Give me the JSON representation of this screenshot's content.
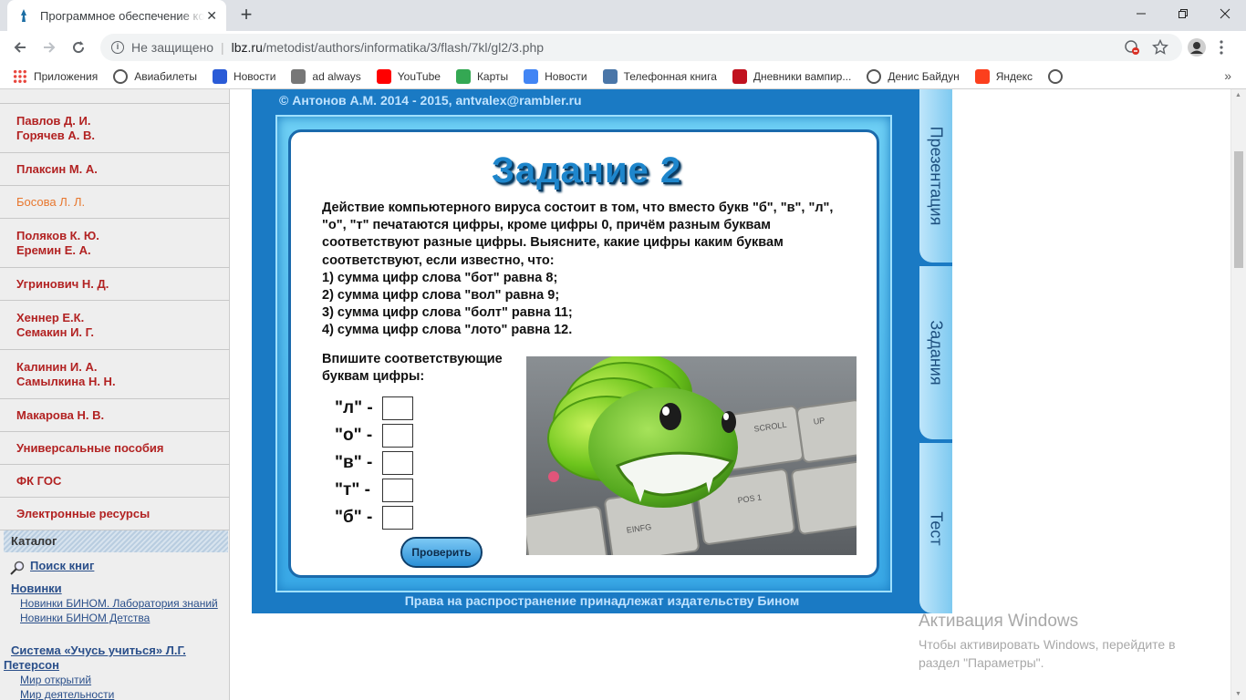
{
  "browser": {
    "tab_title": "Программное обеспечение ко",
    "security_label": "Не защищено",
    "url_domain": "lbz.ru",
    "url_path": "/metodist/authors/informatika/3/flash/7kl/gl2/3.php"
  },
  "bookmarks": [
    {
      "label": "Приложения",
      "icon": "apps-icon",
      "color": "#e8453c"
    },
    {
      "label": "Авиабилеты",
      "icon": "globe-icon",
      "color": "#555555"
    },
    {
      "label": "Новости",
      "icon": "chat-icon",
      "color": "#2a5bd7"
    },
    {
      "label": "ad always",
      "icon": "page-icon",
      "color": "#777777"
    },
    {
      "label": "YouTube",
      "icon": "youtube-icon",
      "color": "#ff0000"
    },
    {
      "label": "Карты",
      "icon": "maps-icon",
      "color": "#34a853"
    },
    {
      "label": "Новости",
      "icon": "gnews-icon",
      "color": "#4285f4"
    },
    {
      "label": "Телефонная книга",
      "icon": "vk-icon",
      "color": "#4a76a8"
    },
    {
      "label": "Дневники вампир...",
      "icon": "wa-icon",
      "color": "#c1121f"
    },
    {
      "label": "Денис Байдун",
      "icon": "globe-icon",
      "color": "#555555"
    },
    {
      "label": "Яндекс",
      "icon": "yandex-icon",
      "color": "#fc3f1d"
    }
  ],
  "sidebar": {
    "items": [
      {
        "line1": "Павлов Д. И.",
        "line2": "Горячев А. В."
      },
      {
        "line1": "Плаксин М. А.",
        "line2": ""
      },
      {
        "line1": "Босова Л. Л.",
        "line2": ""
      },
      {
        "line1": "Поляков К. Ю.",
        "line2": "Еремин Е. А."
      },
      {
        "line1": "Угринович Н. Д.",
        "line2": ""
      },
      {
        "line1": "Хеннер Е.К.",
        "line2": "Семакин И. Г."
      },
      {
        "line1": "Калинин И. А.",
        "line2": "Самылкина Н. Н."
      },
      {
        "line1": "Макарова Н. В.",
        "line2": ""
      },
      {
        "line1": "Универсальные пособия",
        "line2": ""
      },
      {
        "line1": "ФК ГОС",
        "line2": ""
      },
      {
        "line1": "Электронные ресурсы",
        "line2": ""
      }
    ],
    "catalog_title": "Каталог",
    "search_books": "Поиск книг",
    "novelties": "Новинки",
    "novelties_binom_lab": "Новинки БИНОМ. Лаборатория знаний",
    "novelties_binom_kids": "Новинки БИНОМ Детства",
    "system_line1": "Система «Учусь учиться» Л.Г.",
    "system_line2": "Петерсон",
    "world_open": "Мир открытий",
    "world_activity": "Мир деятельности"
  },
  "flash": {
    "copyright": "© Антонов А.М. 2014 - 2015, antvalex@rambler.ru",
    "task_title": "Задание 2",
    "task_lines": [
      "Действие компьютерного вируса состоит в том, что вместо букв \"б\", \"в\", \"л\",",
      "\"о\", \"т\" печатаются цифры, кроме цифры 0, причём разным буквам",
      "соответствуют разные цифры. Выясните, какие цифры каким буквам",
      "соответствуют, если известно, что:",
      "1) сумма цифр слова \"бот\" равна 8;",
      "2) сумма цифр слова \"вол\" равна 9;",
      "3) сумма цифр слова \"болт\" равна 11;",
      "4) сумма цифр слова \"лото\" равна 12."
    ],
    "prompt_line1": "Впишите соответствующие",
    "prompt_line2": "буквам цифры:",
    "answers": [
      {
        "label": "\"л\" -",
        "value": ""
      },
      {
        "label": "\"о\" -",
        "value": ""
      },
      {
        "label": "\"в\" -",
        "value": ""
      },
      {
        "label": "\"т\" -",
        "value": ""
      },
      {
        "label": "\"б\" -",
        "value": ""
      }
    ],
    "check_button": "Проверить",
    "rights": "Права на распространение принадлежат издательству Бином",
    "side_tabs": [
      "Презентация",
      "Задания",
      "Тест"
    ]
  },
  "activation": {
    "title": "Активация Windows",
    "line1": "Чтобы активировать Windows, перейдите в",
    "line2": "раздел \"Параметры\"."
  }
}
